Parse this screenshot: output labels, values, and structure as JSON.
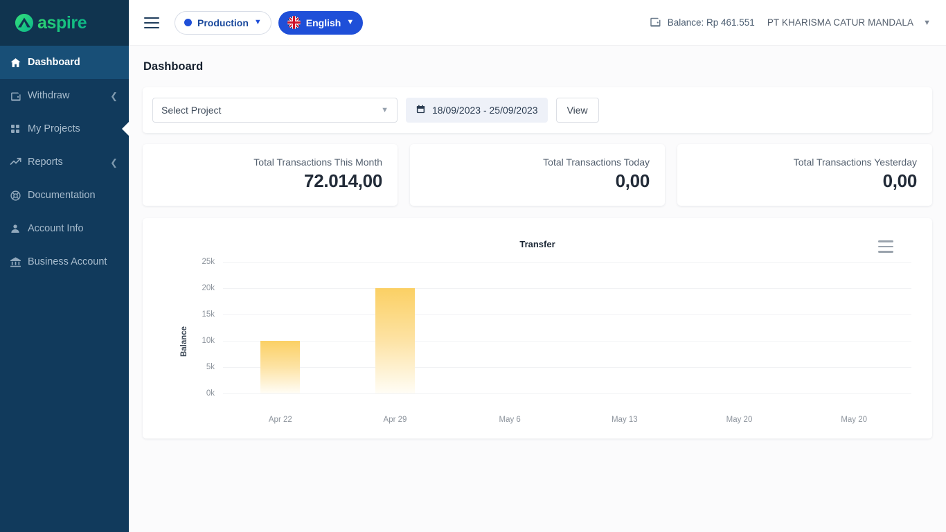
{
  "brand": {
    "name": "aspire",
    "mark_icon": "aspire-mountain-logo"
  },
  "topbar": {
    "menu_icon": "hamburger-menu-icon",
    "environment": {
      "label": "Production",
      "dot_color": "#1f4fd8",
      "caret_icon": "chevron-down-icon"
    },
    "language": {
      "label": "English",
      "flag_icon": "uk-flag-icon",
      "caret_icon": "chevron-down-icon"
    },
    "balance": {
      "icon": "wallet-icon",
      "text": "Balance: Rp 461.551"
    },
    "company": {
      "name": "PT KHARISMA CATUR MANDALA",
      "caret_icon": "chevron-down-icon"
    }
  },
  "sidebar": {
    "items": [
      {
        "label": "Dashboard",
        "icon": "home-icon",
        "active": true,
        "expandable": false
      },
      {
        "label": "Withdraw",
        "icon": "wallet-icon",
        "active": false,
        "expandable": true
      },
      {
        "label": "My Projects",
        "icon": "grid-icon",
        "active": false,
        "expandable": false
      },
      {
        "label": "Reports",
        "icon": "trending-up-icon",
        "active": false,
        "expandable": true
      },
      {
        "label": "Documentation",
        "icon": "lifebuoy-icon",
        "active": false,
        "expandable": false
      },
      {
        "label": "Account Info",
        "icon": "user-icon",
        "active": false,
        "expandable": false
      },
      {
        "label": "Business Account",
        "icon": "bank-icon",
        "active": false,
        "expandable": false
      }
    ]
  },
  "page": {
    "title": "Dashboard"
  },
  "filters": {
    "project": {
      "value": "Select Project",
      "caret_icon": "chevron-down-icon"
    },
    "date_range": {
      "value": "18/09/2023 - 25/09/2023",
      "icon": "calendar-icon"
    },
    "view_button": "View"
  },
  "stats": [
    {
      "label": "Total Transactions This Month",
      "value": "72.014,00"
    },
    {
      "label": "Total Transactions Today",
      "value": "0,00"
    },
    {
      "label": "Total Transactions Yesterday",
      "value": "0,00"
    }
  ],
  "chart_data": {
    "type": "bar",
    "title": "Transfer",
    "xlabel": "",
    "ylabel": "Balance",
    "categories": [
      "Apr 22",
      "Apr 29",
      "May 6",
      "May 13",
      "May 20",
      "May 20"
    ],
    "values": [
      10000,
      20000,
      0,
      0,
      0,
      0
    ],
    "ylim": [
      0,
      25000
    ],
    "yticks": [
      0,
      5000,
      10000,
      15000,
      20000,
      25000
    ],
    "ytick_labels": [
      "0k",
      "5k",
      "10k",
      "15k",
      "20k",
      "25k"
    ],
    "grid": true,
    "legend": "none",
    "bar_color_top": "#fbd064",
    "bar_color_bottom": "#fffdf6",
    "menu_icon": "chart-menu-icon"
  },
  "colors": {
    "sidebar_bg": "#113a5c",
    "sidebar_active": "#184f77",
    "accent_blue": "#1f4fd8",
    "brand_green": "#1ec97a",
    "page_bg": "#fbfbfc"
  }
}
